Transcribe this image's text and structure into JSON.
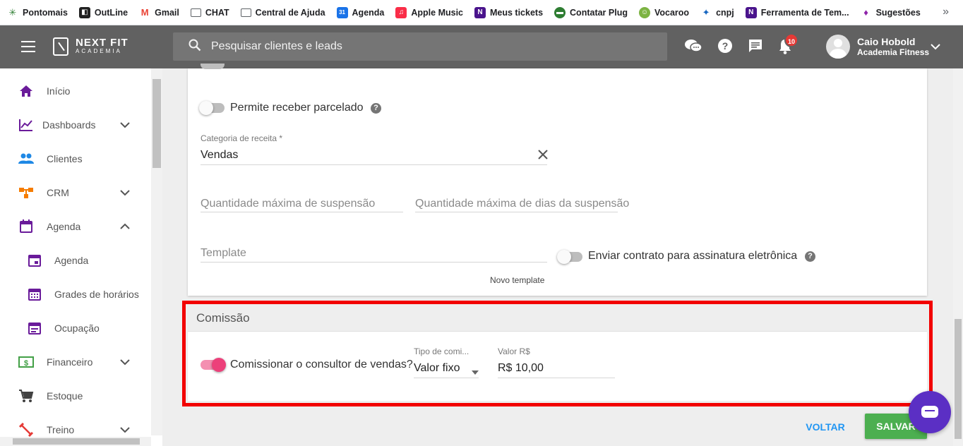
{
  "bookmarks": [
    {
      "label": "Pontomais",
      "icon": "pontomais-icon",
      "color": "#2e7d32"
    },
    {
      "label": "OutLine",
      "icon": "outline-icon",
      "color": "#212121"
    },
    {
      "label": "Gmail",
      "icon": "gmail-icon",
      "color": "#ea4335"
    },
    {
      "label": "CHAT",
      "icon": "folder-icon",
      "color": "#5f6368"
    },
    {
      "label": "Central de Ajuda",
      "icon": "folder-icon",
      "color": "#5f6368"
    },
    {
      "label": "Agenda",
      "icon": "calendar-icon",
      "color": "#1a73e8"
    },
    {
      "label": "Apple Music",
      "icon": "apple-music-icon",
      "color": "#fa2d48"
    },
    {
      "label": "Meus tickets",
      "icon": "nextfit-icon",
      "color": "#6a1b9a"
    },
    {
      "label": "Contatar Plug",
      "icon": "plug-icon",
      "color": "#2e7d32"
    },
    {
      "label": "Vocaroo",
      "icon": "vocaroo-icon",
      "color": "#7cb342"
    },
    {
      "label": "cnpj",
      "icon": "cnpj-icon",
      "color": "#1565c0"
    },
    {
      "label": "Ferramenta de Tem...",
      "icon": "nextfit-icon",
      "color": "#6a1b9a"
    },
    {
      "label": "Sugestões",
      "icon": "lightbulb-icon",
      "color": "#8e24aa"
    }
  ],
  "bookmarks_more": "»",
  "header": {
    "logo_line1": "NEXT FIT",
    "logo_line2": "ACADEMIA",
    "search_placeholder": "Pesquisar clientes e leads",
    "notification_count": "10",
    "user_name": "Caio Hobold",
    "user_company": "Academia Fitness"
  },
  "sidebar": {
    "items": [
      {
        "label": "Início",
        "icon": "home-icon",
        "color": "#6a1b9a"
      },
      {
        "label": "Dashboards",
        "icon": "chart-line-icon",
        "color": "#6a1b9a",
        "chevron": "down"
      },
      {
        "label": "Clientes",
        "icon": "people-icon",
        "color": "#1e88e5"
      },
      {
        "label": "CRM",
        "icon": "crm-icon",
        "color": "#f57c00",
        "chevron": "down"
      },
      {
        "label": "Agenda",
        "icon": "calendar-icon",
        "color": "#6a1b9a",
        "chevron": "up"
      },
      {
        "label": "Agenda",
        "icon": "calendar-icon",
        "color": "#6a1b9a",
        "sub": true
      },
      {
        "label": "Grades de horários",
        "icon": "calendar-grid-icon",
        "color": "#6a1b9a",
        "sub": true
      },
      {
        "label": "Ocupação",
        "icon": "calendar-list-icon",
        "color": "#6a1b9a",
        "sub": true
      },
      {
        "label": "Financeiro",
        "icon": "money-icon",
        "color": "#43a047",
        "chevron": "down"
      },
      {
        "label": "Estoque",
        "icon": "cart-icon",
        "color": "#424242"
      },
      {
        "label": "Treino",
        "icon": "dumbbell-icon",
        "color": "#e53935",
        "chevron": "down"
      }
    ]
  },
  "form": {
    "parcelado_label": "Permite receber parcelado",
    "categoria_label": "Categoria de receita *",
    "categoria_value": "Vendas",
    "qtd_suspensao_placeholder": "Quantidade máxima de suspensão",
    "qtd_dias_placeholder": "Quantidade máxima de dias da suspensão",
    "template_placeholder": "Template",
    "novo_template": "Novo template",
    "enviar_contrato_label": "Enviar contrato para assinatura eletrônica"
  },
  "comissao": {
    "title": "Comissão",
    "comissionar_label": "Comissionar o consultor de vendas?",
    "comissionar_on": true,
    "tipo_label": "Tipo de comi...",
    "tipo_value": "Valor fixo",
    "valor_label": "Valor R$",
    "valor_value": "R$ 10,00"
  },
  "actions": {
    "voltar": "VOLTAR",
    "salvar": "SALVAR"
  },
  "colors": {
    "appbar": "#616161",
    "highlight_border": "#f20000",
    "toggle_on": "#ec407a",
    "save_button": "#4caf50",
    "link_blue": "#2196f3",
    "chat_widget": "#5b2fc4"
  }
}
